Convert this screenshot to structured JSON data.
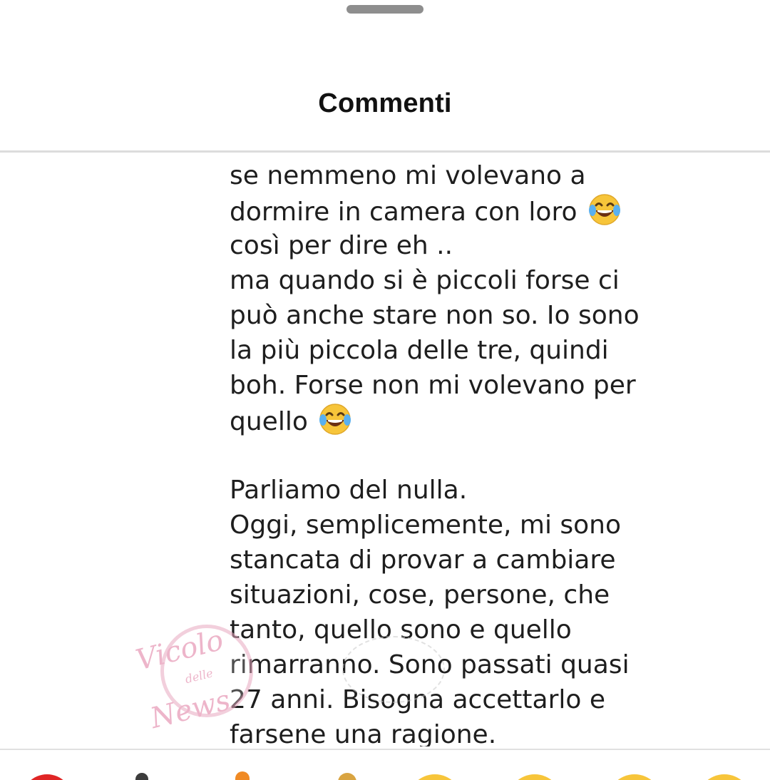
{
  "header": {
    "title": "Commenti"
  },
  "comment": {
    "lines": [
      "se nemmeno mi volevano a",
      "dormire in camera con loro",
      "così per dire eh ..",
      "ma quando si è piccoli forse ci",
      "può anche stare non so. Io sono",
      "la più piccola delle tre, quindi",
      "boh. Forse non mi volevano per",
      "quello",
      "",
      "Parliamo del nulla.",
      "Oggi, semplicemente, mi sono",
      "stancata di provar a cambiare",
      "situazioni, cose, persone, che",
      "tanto, quello sono e quello",
      "rimarranno. Sono passati quasi",
      "27 anni. Bisogna accettarlo e",
      "farsene una ragione."
    ],
    "emoji_after_lines": [
      1,
      7
    ],
    "emoji_icon": "face-with-tears-of-joy-icon"
  },
  "watermark": {
    "brand_main": "Vicolo",
    "brand_small": "delle",
    "brand_end": "News"
  },
  "reactions": [
    {
      "icon": "heart-icon"
    },
    {
      "icon": "clapping-hands-icon"
    },
    {
      "icon": "fire-icon"
    },
    {
      "icon": "raised-hands-icon"
    },
    {
      "icon": "crying-face-icon"
    },
    {
      "icon": "heart-eyes-face-icon"
    },
    {
      "icon": "surprised-face-icon"
    },
    {
      "icon": "laughing-face-icon"
    }
  ],
  "colors": {
    "text": "#1e1e1e",
    "handle": "#8e8e8e",
    "divider": "#dcdcdc",
    "heart": "#e02525",
    "emoji_yellow": "#f7c53a"
  }
}
